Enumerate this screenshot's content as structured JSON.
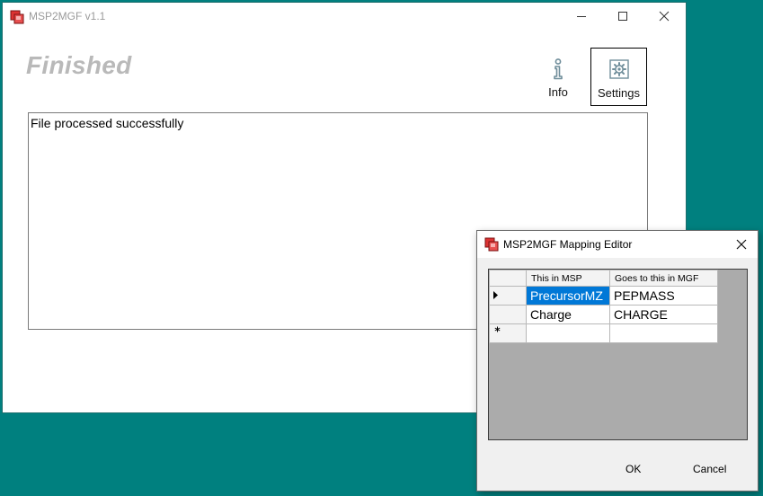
{
  "main_window": {
    "title": "MSP2MGF v1.1",
    "status": "Finished",
    "toolbar": {
      "info_label": "Info",
      "settings_label": "Settings"
    },
    "log_text": "File processed successfully"
  },
  "mapping_editor": {
    "title": "MSP2MGF Mapping Editor",
    "columns": [
      "This in MSP",
      "Goes to this in MGF"
    ],
    "rows": [
      {
        "msp": "PrecursorMZ",
        "mgf": "PEPMASS"
      },
      {
        "msp": "Charge",
        "mgf": "CHARGE"
      }
    ],
    "ok_label": "OK",
    "cancel_label": "Cancel"
  },
  "colors": {
    "desktop": "#00807f",
    "selection": "#0078d7",
    "status_text": "#b9b9b9",
    "grid_background": "#ababab"
  },
  "icons": {
    "app": "app-icon",
    "info": "info-icon",
    "settings": "gear-icon",
    "current_row": "row-pointer-icon",
    "new_row": "new-row-asterisk-icon"
  }
}
